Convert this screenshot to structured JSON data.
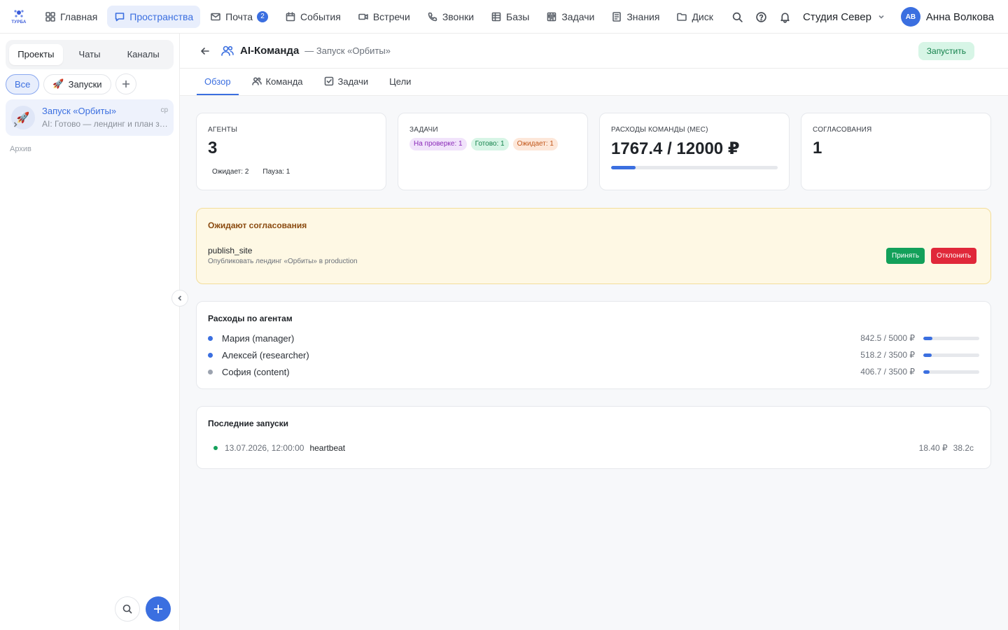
{
  "brand": {
    "logo_text": "ТУРБА"
  },
  "nav": {
    "items": [
      {
        "label": "Главная",
        "icon": "grid-icon"
      },
      {
        "label": "Пространства",
        "icon": "chat-icon",
        "active": true
      },
      {
        "label": "Почта",
        "icon": "mail-icon",
        "badge": "2"
      },
      {
        "label": "События",
        "icon": "calendar-icon"
      },
      {
        "label": "Встречи",
        "icon": "video-icon"
      },
      {
        "label": "Звонки",
        "icon": "phone-icon"
      },
      {
        "label": "Базы",
        "icon": "table-icon"
      },
      {
        "label": "Задачи",
        "icon": "kanban-icon"
      },
      {
        "label": "Знания",
        "icon": "book-icon"
      },
      {
        "label": "Диск",
        "icon": "folder-icon"
      }
    ],
    "org_name": "Студия Север",
    "user": {
      "initials": "АВ",
      "name": "Анна Волкова"
    }
  },
  "sidebar": {
    "segments": [
      "Проекты",
      "Чаты",
      "Каналы"
    ],
    "filters": {
      "all": "Все",
      "launches": "Запуски",
      "launches_emoji": "🚀"
    },
    "project": {
      "emoji": "🚀",
      "title": "Запуск «Орбиты»",
      "subtitle": "AI: Готово — лендинг и план запуска",
      "time": "ср"
    },
    "archive_label": "Архив"
  },
  "header": {
    "title": "AI-Команда",
    "subtitle": "— Запуск «Орбиты»",
    "run_button": "Запустить"
  },
  "tabs": [
    {
      "label": "Обзор",
      "active": true
    },
    {
      "label": "Команда",
      "icon": "users-icon"
    },
    {
      "label": "Задачи",
      "icon": "check-square-icon"
    },
    {
      "label": "Цели"
    }
  ],
  "stats": {
    "agents": {
      "label": "АГЕНТЫ",
      "value": "3",
      "waiting": "Ожидает: 2",
      "paused": "Пауза: 1"
    },
    "tasks": {
      "label": "ЗАДАЧИ",
      "review": "На проверке: 1",
      "done": "Готово: 1",
      "waiting": "Ожидает: 1"
    },
    "spend": {
      "label": "РАСХОДЫ КОМАНДЫ (МЕС)",
      "value": "1767.4 / 12000 ₽",
      "spent": 1767.4,
      "budget": 12000
    },
    "approvals": {
      "label": "СОГЛАСОВАНИЯ",
      "value": "1"
    }
  },
  "approvals": {
    "title": "Ожидают согласования",
    "item": {
      "name": "publish_site",
      "description": "Опубликовать лендинг «Орбиты» в production"
    },
    "accept": "Принять",
    "reject": "Отклонить"
  },
  "agent_spend": {
    "title": "Расходы по агентам",
    "items": [
      {
        "name": "Мария (manager)",
        "amount": "842.5 / 5000 ₽",
        "spent": 842.5,
        "limit": 5000,
        "color": "#3b6fe0"
      },
      {
        "name": "Алексей (researcher)",
        "amount": "518.2 / 3500 ₽",
        "spent": 518.2,
        "limit": 3500,
        "color": "#3b6fe0"
      },
      {
        "name": "София (content)",
        "amount": "406.7 / 3500 ₽",
        "spent": 406.7,
        "limit": 3500,
        "color": "#9ca3af"
      }
    ]
  },
  "recent_runs": {
    "title": "Последние запуски",
    "items": [
      {
        "time": "13.07.2026, 12:00:00",
        "name": "heartbeat",
        "cost": "18.40 ₽",
        "duration": "38.2с"
      }
    ]
  },
  "colors": {
    "accent": "#3b6fe0",
    "success": "#13a05a",
    "danger": "#e0283a",
    "warning_bg": "#fef8e4"
  }
}
